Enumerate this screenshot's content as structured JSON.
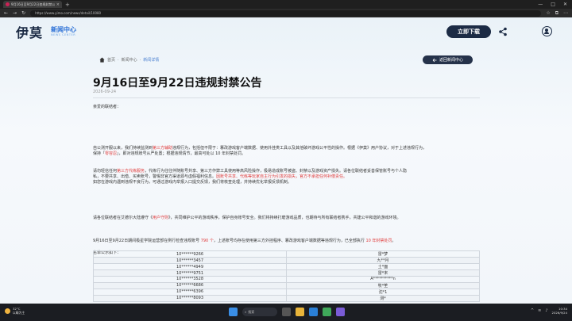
{
  "browser": {
    "tab_title": "9月16日至9月22日违规封禁公告",
    "tab_close": "×",
    "new_tab": "+",
    "url": "https://www.yimo.com/news/detail/10080",
    "controls": [
      "—",
      "□",
      "✕"
    ]
  },
  "header": {
    "logo": "伊莫",
    "news_center": "新闻中心",
    "news_center_en": "NEWS CENTER",
    "download_label": "立即下载"
  },
  "breadcrumb": {
    "home": "首页",
    "sep": "·",
    "section": "新闻中心",
    "current": "新闻详情"
  },
  "back_label": "返回新闻中心",
  "article": {
    "title": "9月16日至9月22日违规封禁公告",
    "date": "2026-09-24",
    "greeting": "亲爱的联结者：",
    "p1_a": "自公测开服以来，我们持续监测到",
    "p1_red": "第三方辅助",
    "p1_b": "违规行为，包括但不限于：篡改游戏客户端数据、使用外挂类工具以及其他破坏游戏公平性的操作。根据《伊莫》用户协议，对于上述违规行为，",
    "p1_c": "保持「",
    "p1_red2": "零容忍",
    "p1_d": "」，即对违规账号从严处置；根据违规情节，最高可处以 10 年封禁处罚。",
    "p2_a": "请勿轻信任何",
    "p2_red": "第三方代练服务",
    "p2_b": "，代练行为往往伴随账号共享、第三方作弊工具使用等高风险操作，极易造成账号被盗、封禁以及游戏资产损失。请各位联结者妥善保管账号与个人隐",
    "p2_c": "私，不要共享、出借、买卖账号，警惕非官方渠道源与虚假福利信息。",
    "p2_red2": "因账号共享、代练等玩家自主行为引发的损失，官方不承担任何补偿责任。",
    "p2_d": "如您在游戏内遇到违规不良行为，可通过游戏内举报入口提交反馈，我们将核查处理，并持续优化举报反馈机制。",
    "p3_a": "请各位联结者在艾德尔大陆遵守《",
    "p3_link": "用户守则",
    "p3_b": "》，共同维护公平的游戏秩序，保护自身账号安全。我们将持续打磨游戏品质，也期待与所有联结者携手，共建公平和谐的游戏环境。",
    "p4_a": "9月16日至9月22日期间极星学院运营部在例行检查违规账号 ",
    "p4_count": "790 个",
    "p4_b": "，上述账号均存在使用第三方外挂程序、篡改游戏客户端数据等违规行为，已全部执行 ",
    "p4_red": "10 年封禁处罚",
    "p4_c": "。",
    "p5": "名单公示如下："
  },
  "banned_list": [
    {
      "id": "10******9266",
      "name": "雷*梦"
    },
    {
      "id": "10******3457",
      "name": "九**月"
    },
    {
      "id": "10******4949",
      "name": "土*面"
    },
    {
      "id": "10******9751",
      "name": "雷*末"
    },
    {
      "id": "10******3528",
      "name": "A**********n"
    },
    {
      "id": "10******6686",
      "name": "牧*笙"
    },
    {
      "id": "10******6396",
      "name": "沈*1"
    },
    {
      "id": "10******8093",
      "name": "测*"
    }
  ],
  "taskbar": {
    "weather_temp": "32°C",
    "weather_desc": "以晴为主",
    "search": "搜索",
    "time": "10:34",
    "date": "2026/9/24"
  },
  "colors": {
    "accent_dark": "#1c2b45",
    "link_blue": "#2a6fd6",
    "warning_red": "#e03a3a"
  }
}
